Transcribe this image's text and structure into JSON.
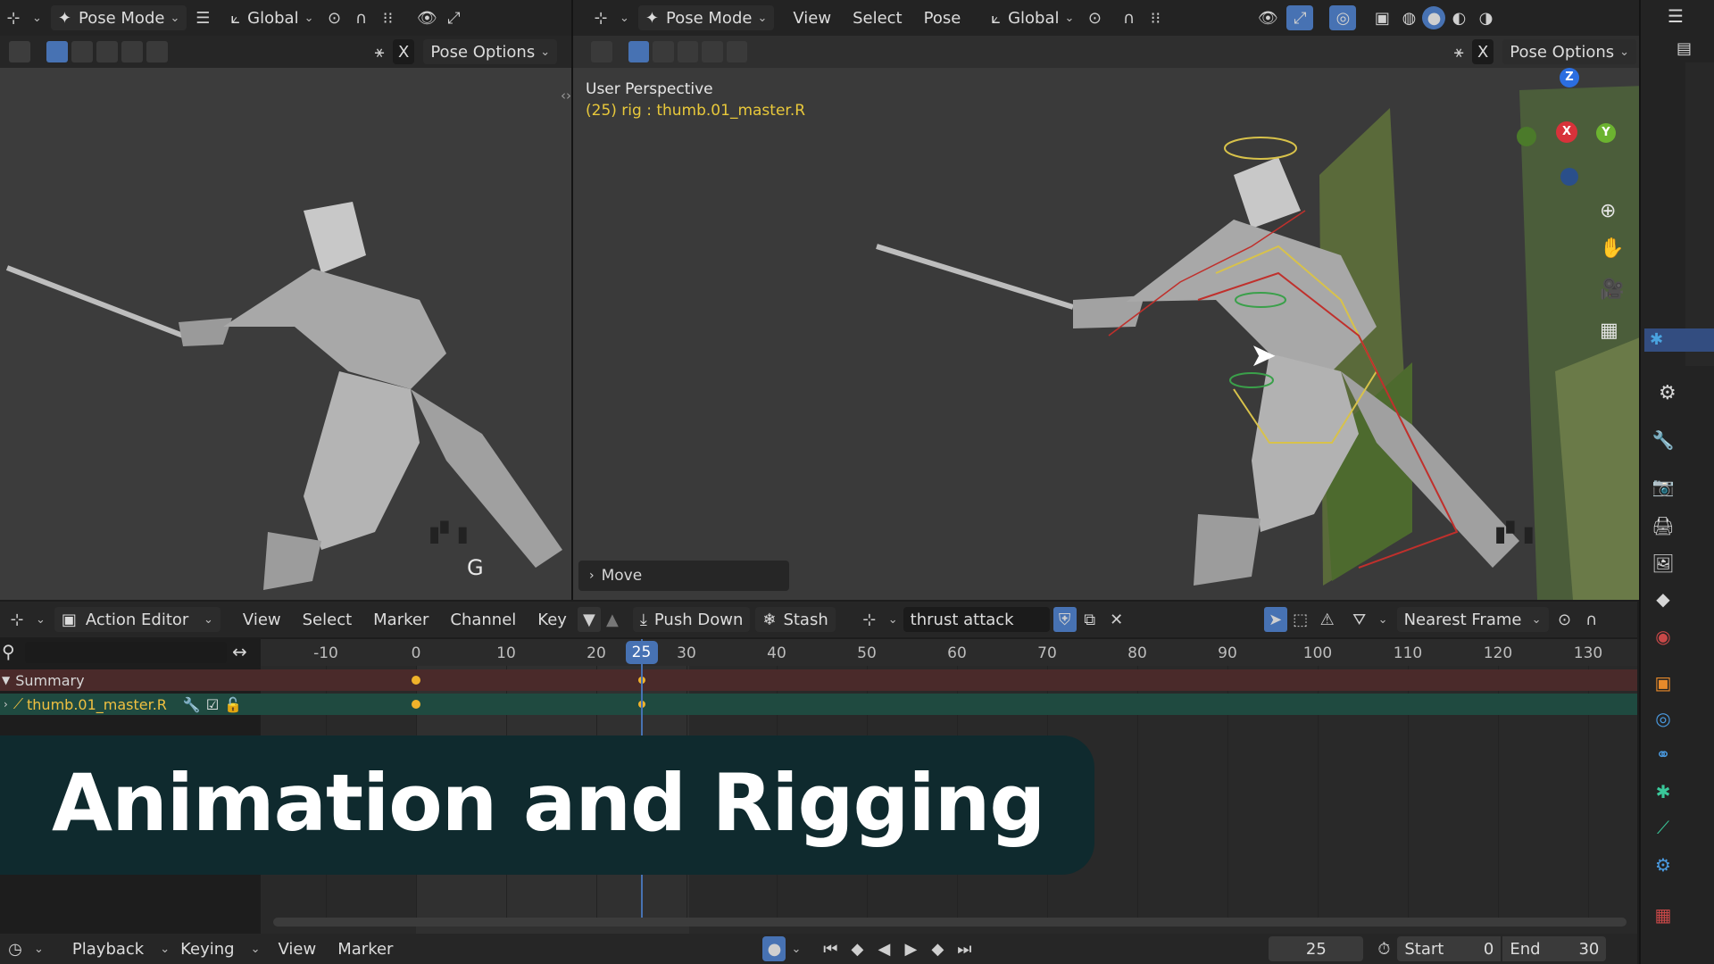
{
  "left_view": {
    "mode": "Pose Mode",
    "orientation": "Global",
    "options": "Pose Options",
    "x_label": "X",
    "key_hint": "G"
  },
  "right_view": {
    "mode": "Pose Mode",
    "menus": [
      "View",
      "Select",
      "Pose"
    ],
    "orientation": "Global",
    "options": "Pose Options",
    "x_label": "X",
    "perspective": "User Perspective",
    "active_bone": "(25) rig : thumb.01_master.R",
    "operator_panel": "Move",
    "gizmo": {
      "z": "Z",
      "x": "X",
      "y": "Y"
    }
  },
  "action_editor": {
    "editor": "Action Editor",
    "menus": [
      "View",
      "Select",
      "Marker",
      "Channel",
      "Key"
    ],
    "push_down": "Push Down",
    "stash": "Stash",
    "action_name": "thrust attack",
    "snap": "Nearest Frame",
    "current_frame": "25",
    "ticks": [
      {
        "value": -10,
        "label": "-10"
      },
      {
        "value": 0,
        "label": "0"
      },
      {
        "value": 10,
        "label": "10"
      },
      {
        "value": 20,
        "label": "20"
      },
      {
        "value": 30,
        "label": "30"
      },
      {
        "value": 40,
        "label": "40"
      },
      {
        "value": 50,
        "label": "50"
      },
      {
        "value": 60,
        "label": "60"
      },
      {
        "value": 70,
        "label": "70"
      },
      {
        "value": 80,
        "label": "80"
      },
      {
        "value": 90,
        "label": "90"
      },
      {
        "value": 100,
        "label": "100"
      },
      {
        "value": 110,
        "label": "110"
      },
      {
        "value": 120,
        "label": "120"
      },
      {
        "value": 130,
        "label": "130"
      }
    ],
    "channels": [
      "Summary",
      "thumb.01_master.R"
    ],
    "keyframes": [
      0,
      25
    ]
  },
  "timeline": {
    "menus": [
      "Playback",
      "Keying",
      "View",
      "Marker"
    ],
    "frame": "25",
    "start_label": "Start",
    "start_value": "0",
    "end_label": "End",
    "end_value": "30"
  },
  "overlay": {
    "title": "Animation and Rigging"
  },
  "colors": {
    "accent": "#4772b3",
    "keyframe": "#f0b22a",
    "banner": "#0f2a2e",
    "summary_row": "#4a2a2a",
    "channel_row": "#1f4a40"
  }
}
